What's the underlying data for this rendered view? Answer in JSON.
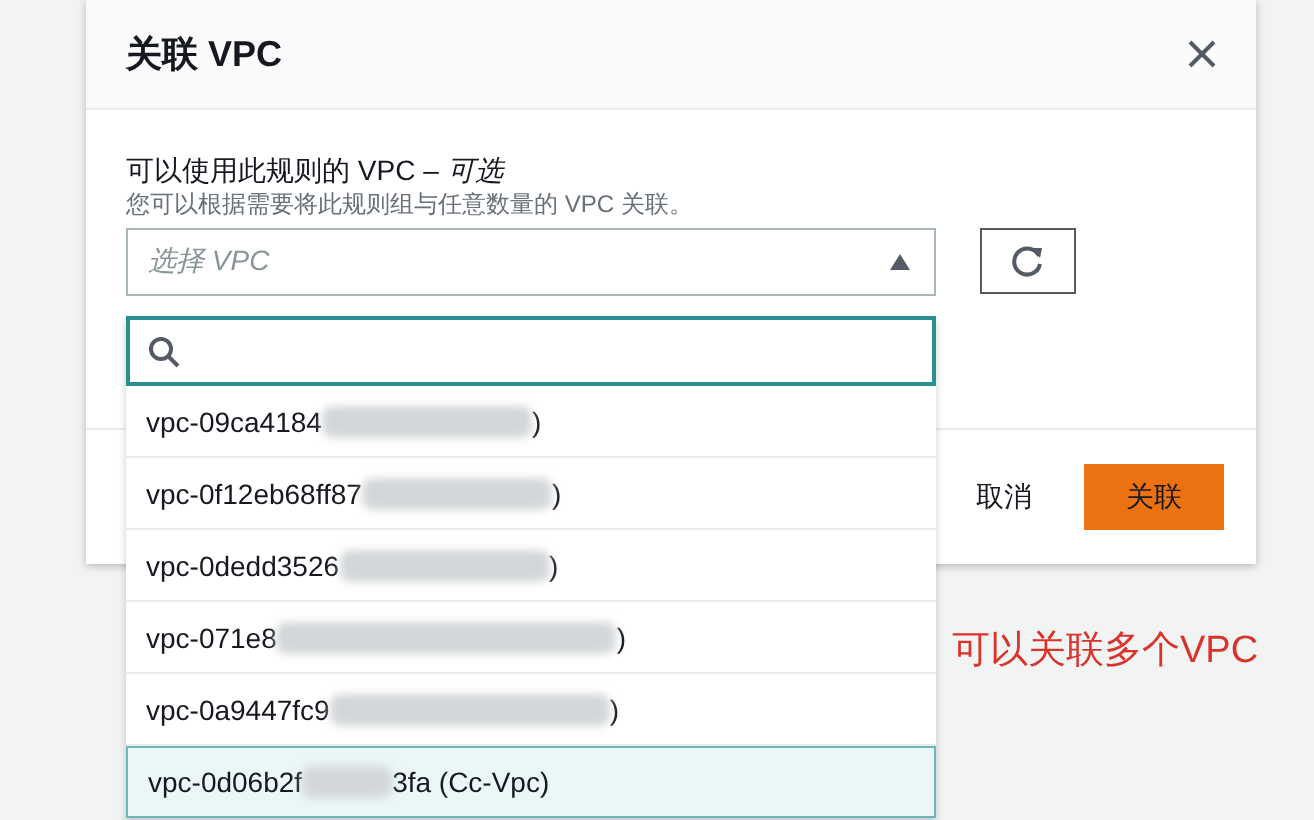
{
  "dialog": {
    "title": "关联 VPC"
  },
  "field": {
    "label": "可以使用此规则的 VPC – *可选*",
    "description": "您可以根据需要将此规则组与任意数量的 VPC 关联。"
  },
  "select": {
    "placeholder": "选择 VPC",
    "expanded": true
  },
  "dropdown": {
    "items": [
      {
        "prefix": "vpc-09ca4184",
        "redacted": true,
        "suffix": ")",
        "selected": false
      },
      {
        "prefix": "vpc-0f12eb68ff87",
        "redacted": true,
        "suffix": ")",
        "selected": false
      },
      {
        "prefix": "vpc-0dedd3526",
        "redacted": true,
        "suffix": ")",
        "selected": false
      },
      {
        "prefix": "vpc-071e8",
        "redacted": true,
        "suffix": ")",
        "selected": false
      },
      {
        "prefix": "vpc-0a9447fc9",
        "redacted": true,
        "suffix": ")",
        "selected": false
      },
      {
        "prefix": "vpc-0d06b2f",
        "redacted": true,
        "suffix": "3fa (Cc-Vpc)",
        "selected": true
      }
    ]
  },
  "buttons": {
    "cancel": "取消",
    "confirm": "关联"
  },
  "annotation": "可以关联多个VPC"
}
